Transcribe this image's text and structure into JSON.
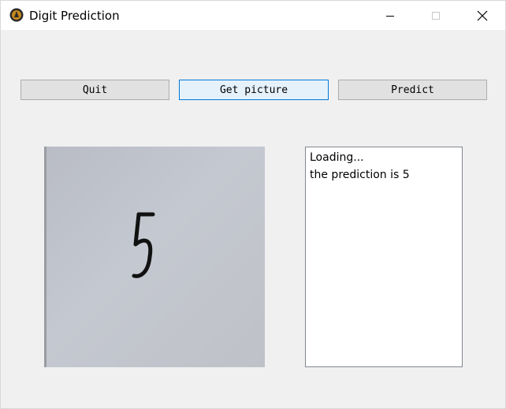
{
  "window": {
    "title": "Digit Prediction",
    "icon": "app-icon"
  },
  "titlebar_controls": {
    "minimize_icon": "minimize-icon",
    "maximize_icon": "maximize-icon",
    "close_icon": "close-icon"
  },
  "toolbar": {
    "quit_label": "Quit",
    "get_picture_label": "Get picture",
    "predict_label": "Predict"
  },
  "picture": {
    "digit_shown": "5"
  },
  "output": {
    "lines": [
      "Loading...",
      "the prediction is 5"
    ]
  },
  "colors": {
    "window_bg": "#f0f0f0",
    "button_bg": "#e1e1e1",
    "focus_border": "#0078d7",
    "focus_bg": "#e5f1fb"
  }
}
